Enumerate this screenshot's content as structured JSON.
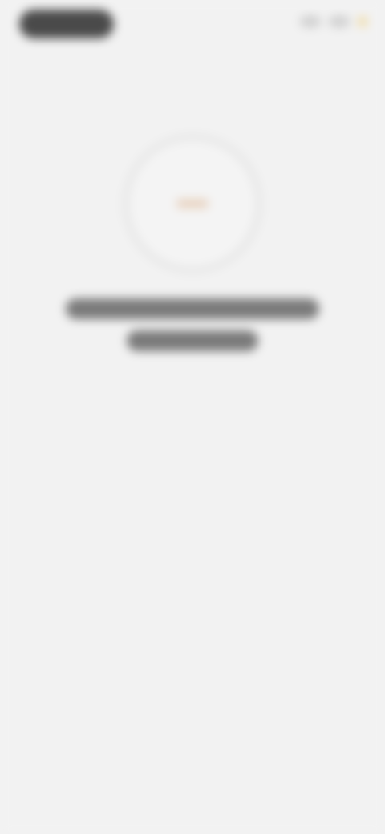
{
  "status_bar": {
    "left_pill_text": "",
    "right_icons": [
      "signal-icon",
      "wifi-icon",
      "battery-icon"
    ],
    "accent": "#f0dca8"
  },
  "loading": {
    "spinner_icon": "loading-spinner-icon",
    "ring_color": "#e3e3e3",
    "center_color": "#e6cdb8"
  },
  "message": {
    "line1": "",
    "line2": ""
  },
  "colors": {
    "background": "#f2f2f2",
    "text": "#7a7a7a",
    "pill": "#4a4a4a"
  }
}
